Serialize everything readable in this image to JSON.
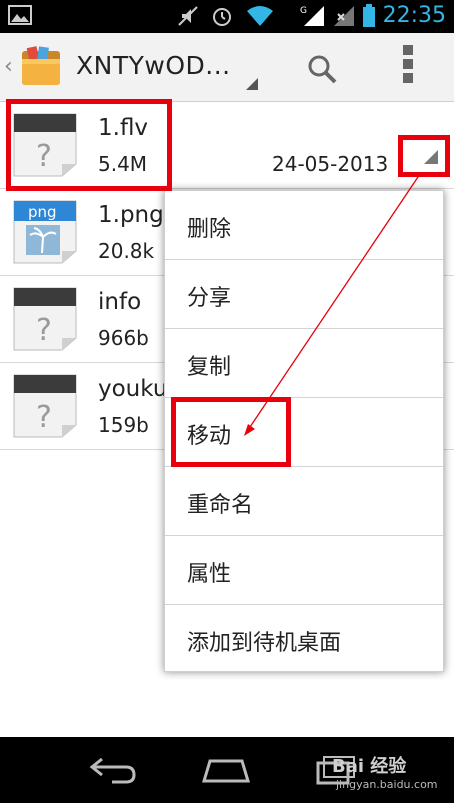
{
  "status_bar": {
    "time": "22:35",
    "icons": [
      "image-icon",
      "mute-icon",
      "alarm-icon",
      "wifi-icon",
      "signal-icon",
      "no-sim-icon",
      "battery-icon"
    ]
  },
  "action_bar": {
    "title": "XNTYwOD...",
    "icons": [
      "up-caret-icon",
      "file-manager-app-icon",
      "search-icon",
      "overflow-menu-icon"
    ]
  },
  "files": [
    {
      "name": "1.flv",
      "size": "5.4M",
      "date": "24-05-2013",
      "icon": "unknown-file-icon"
    },
    {
      "name": "1.png",
      "size": "20.8k",
      "icon": "png-file-icon",
      "icon_label": "png"
    },
    {
      "name": "info",
      "size": "966b",
      "icon": "unknown-file-icon"
    },
    {
      "name": "youku",
      "size": "159b",
      "icon": "unknown-file-icon"
    }
  ],
  "context_menu": {
    "items": [
      "删除",
      "分享",
      "复制",
      "移动",
      "重命名",
      "属性",
      "添加到待机桌面"
    ]
  },
  "annotations": {
    "color": "#e8000c"
  },
  "navigation_bar": {
    "icons": [
      "back-icon",
      "home-icon",
      "recent-apps-icon"
    ]
  },
  "watermark": {
    "text": "Bai 经验",
    "sub": "jingyan.baidu.com"
  },
  "colors": {
    "accent": "#33b5e5",
    "annotation": "#e8000c",
    "statusbar": "#000000"
  }
}
